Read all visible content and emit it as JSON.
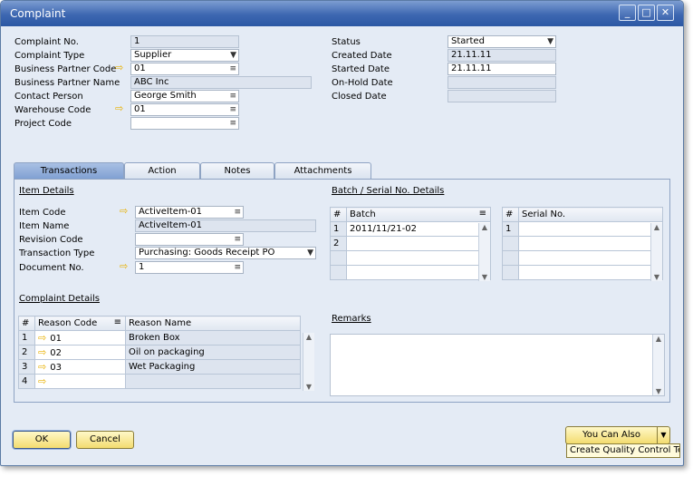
{
  "window": {
    "title": "Complaint",
    "btn_min": "_",
    "btn_max": "□",
    "btn_close": "✕"
  },
  "header_left": [
    {
      "label": "Complaint No.",
      "value": "1"
    },
    {
      "label": "Complaint Type",
      "value": "Supplier"
    },
    {
      "label": "Business Partner Code",
      "value": "01"
    },
    {
      "label": "Business Partner Name",
      "value": "ABC Inc"
    },
    {
      "label": "Contact Person",
      "value": "George Smith"
    },
    {
      "label": "Warehouse Code",
      "value": "01"
    },
    {
      "label": "Project Code",
      "value": ""
    }
  ],
  "header_right": [
    {
      "label": "Status",
      "value": "Started"
    },
    {
      "label": "Created Date",
      "value": "21.11.11"
    },
    {
      "label": "Started Date",
      "value": "21.11.11"
    },
    {
      "label": "On-Hold Date",
      "value": ""
    },
    {
      "label": "Closed Date",
      "value": ""
    }
  ],
  "tabs": [
    "Transactions",
    "Action",
    "Notes",
    "Attachments"
  ],
  "item_details": {
    "title": "Item Details",
    "fields": [
      {
        "label": "Item Code",
        "value": "ActiveItem-01"
      },
      {
        "label": "Item Name",
        "value": "ActiveItem-01"
      },
      {
        "label": "Revision Code",
        "value": ""
      },
      {
        "label": "Transaction Type",
        "value": "Purchasing: Goods Receipt PO"
      },
      {
        "label": "Document No.",
        "value": "1"
      }
    ]
  },
  "batch_serial": {
    "title": "Batch / Serial No. Details",
    "batch_headers": [
      "#",
      "Batch"
    ],
    "batch_rows": [
      [
        "1",
        "2011/11/21-02"
      ],
      [
        "2",
        ""
      ],
      [
        "",
        ""
      ],
      [
        "",
        ""
      ]
    ],
    "serial_headers": [
      "#",
      "Serial No."
    ],
    "serial_rows": [
      [
        "1",
        ""
      ],
      [
        "",
        ""
      ],
      [
        "",
        ""
      ],
      [
        "",
        ""
      ]
    ]
  },
  "complaint_details": {
    "title": "Complaint Details",
    "headers": [
      "#",
      "Reason Code",
      "Reason Name"
    ],
    "rows": [
      [
        "1",
        "01",
        "Broken Box"
      ],
      [
        "2",
        "02",
        "Oil on packaging"
      ],
      [
        "3",
        "03",
        "Wet Packaging"
      ],
      [
        "4",
        "",
        ""
      ]
    ]
  },
  "remarks": {
    "title": "Remarks",
    "value": ""
  },
  "buttons": {
    "ok": "OK",
    "cancel": "Cancel",
    "you_can_also": "You Can Also"
  },
  "tooltip": "Create Quality Control Test",
  "icons": {
    "link_arrow": "⇨",
    "list": "≡",
    "dropdown": "▼",
    "scroll_up": "▲",
    "scroll_down": "▼"
  }
}
